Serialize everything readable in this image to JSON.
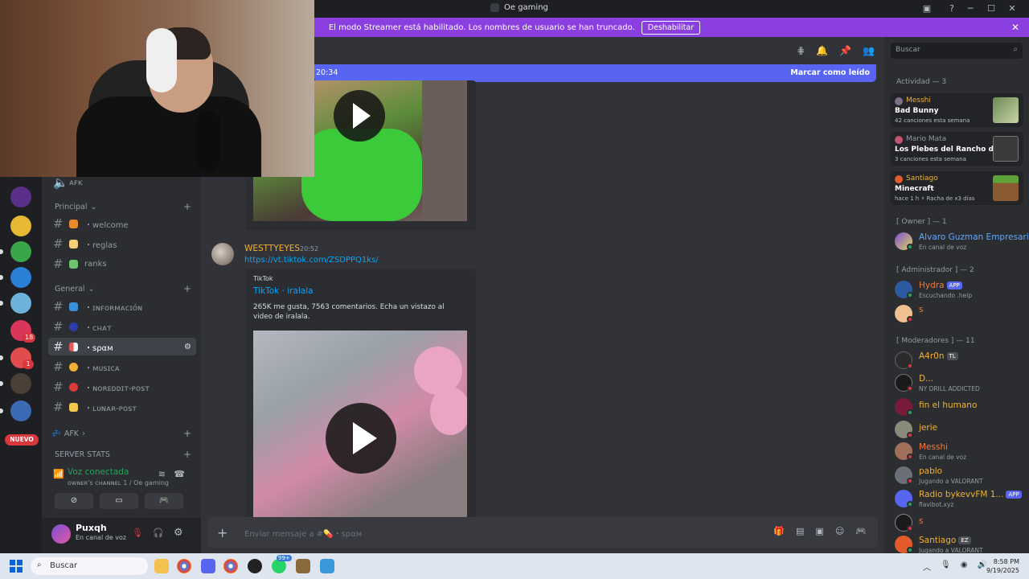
{
  "window": {
    "title": "Oe gaming"
  },
  "banner": {
    "text": "El modo Streamer está habilitado. Los nombres de usuario se han truncado.",
    "button": "Deshabilitar"
  },
  "rail": {
    "badges": [
      "18",
      "1"
    ],
    "new_label": "NUEVO"
  },
  "channels": {
    "afk_top": "ᴀꜰᴋ",
    "cat_principal": "Principal",
    "principal": [
      {
        "label": "・welcome"
      },
      {
        "label": "・reglas"
      },
      {
        "label": "ranks"
      }
    ],
    "cat_general": "General",
    "general": [
      {
        "label": "・ɪɴꜰᴏʀᴍᴀᴄɪóɴ"
      },
      {
        "label": "・ᴄʜᴀᴛ"
      },
      {
        "label": "・ѕραм"
      },
      {
        "label": "・ᴍᴜѕɪᴄᴀ"
      },
      {
        "label": "・ɴᴏʀᴇᴅᴅɪᴛ-ᴘᴏѕᴛ"
      },
      {
        "label": "・ʟᴜɴᴀʀ-ᴘᴏѕᴛ"
      }
    ],
    "cat_afk": "AFK",
    "cat_stats": "SERVER STATS"
  },
  "voice": {
    "title": "Voz conectada",
    "channel": "ᴏᴡɴᴇʀ's ᴄʜᴀɴɴᴇʟ 1 / Oe gaming"
  },
  "user": {
    "name": "Puxqh",
    "status": "En canal de voz"
  },
  "chat": {
    "new_since": "20:34",
    "mark_read": "Marcar como leído",
    "message": {
      "author": "WESTTYEYES",
      "time": "20:52",
      "link": "https://vt.tiktok.com/ZSDPPQ1ks/"
    },
    "embed": {
      "provider": "TikTok",
      "title": "TikTok · iralala",
      "description": "265K me gusta, 7563 comentarios. Echa un vistazo al video de iralala."
    },
    "composer_placeholder": "Enviar mensaje a #💊・ѕραм"
  },
  "members": {
    "search_placeholder": "Buscar",
    "activity_header": "Actividad — 3",
    "activities": [
      {
        "who": "Messhi",
        "what": "Bad Bunny",
        "detail": "42 canciones esta semana"
      },
      {
        "who": "Mario Mata",
        "what": "Los Plebes del Rancho de A...",
        "detail": "3 canciones esta semana"
      },
      {
        "who": "Santiago",
        "what": "Minecraft",
        "detail": "hace 1 h   ⚡ Racha de x3 días"
      }
    ],
    "owner_header": "[ Owner ] — 1",
    "owner": [
      {
        "name": "Alvaro Guzman Empresario",
        "sub": "En canal de voz"
      }
    ],
    "admin_header": "[ Administrador ] — 2",
    "admins": [
      {
        "name": "Hydra",
        "tag": "APP",
        "sub": "Escuchando .help"
      },
      {
        "name": "s",
        "sub": ""
      }
    ],
    "mod_header": "[ Moderadores ] — 11",
    "mods": [
      {
        "name": "A4r0n",
        "tag": "TL",
        "sub": ""
      },
      {
        "name": "D...",
        "sub": "NY DRILL ADDICTED"
      },
      {
        "name": "fin el humano",
        "sub": ""
      },
      {
        "name": "jerie",
        "sub": ""
      },
      {
        "name": "Messhi",
        "sub": "En canal de voz"
      },
      {
        "name": "pablo",
        "sub": "Jugando a VALORANT"
      },
      {
        "name": "Radio bykevvFM 1...",
        "tag": "APP",
        "sub": "flavibot.xyz"
      },
      {
        "name": "s",
        "sub": ""
      },
      {
        "name": "Santiago",
        "tag": "EZ",
        "sub": "Jugando a VALORANT"
      }
    ]
  },
  "taskbar": {
    "search": "Buscar",
    "time": "8:58 PM",
    "date": "9/19/2025",
    "badge": "99+"
  }
}
